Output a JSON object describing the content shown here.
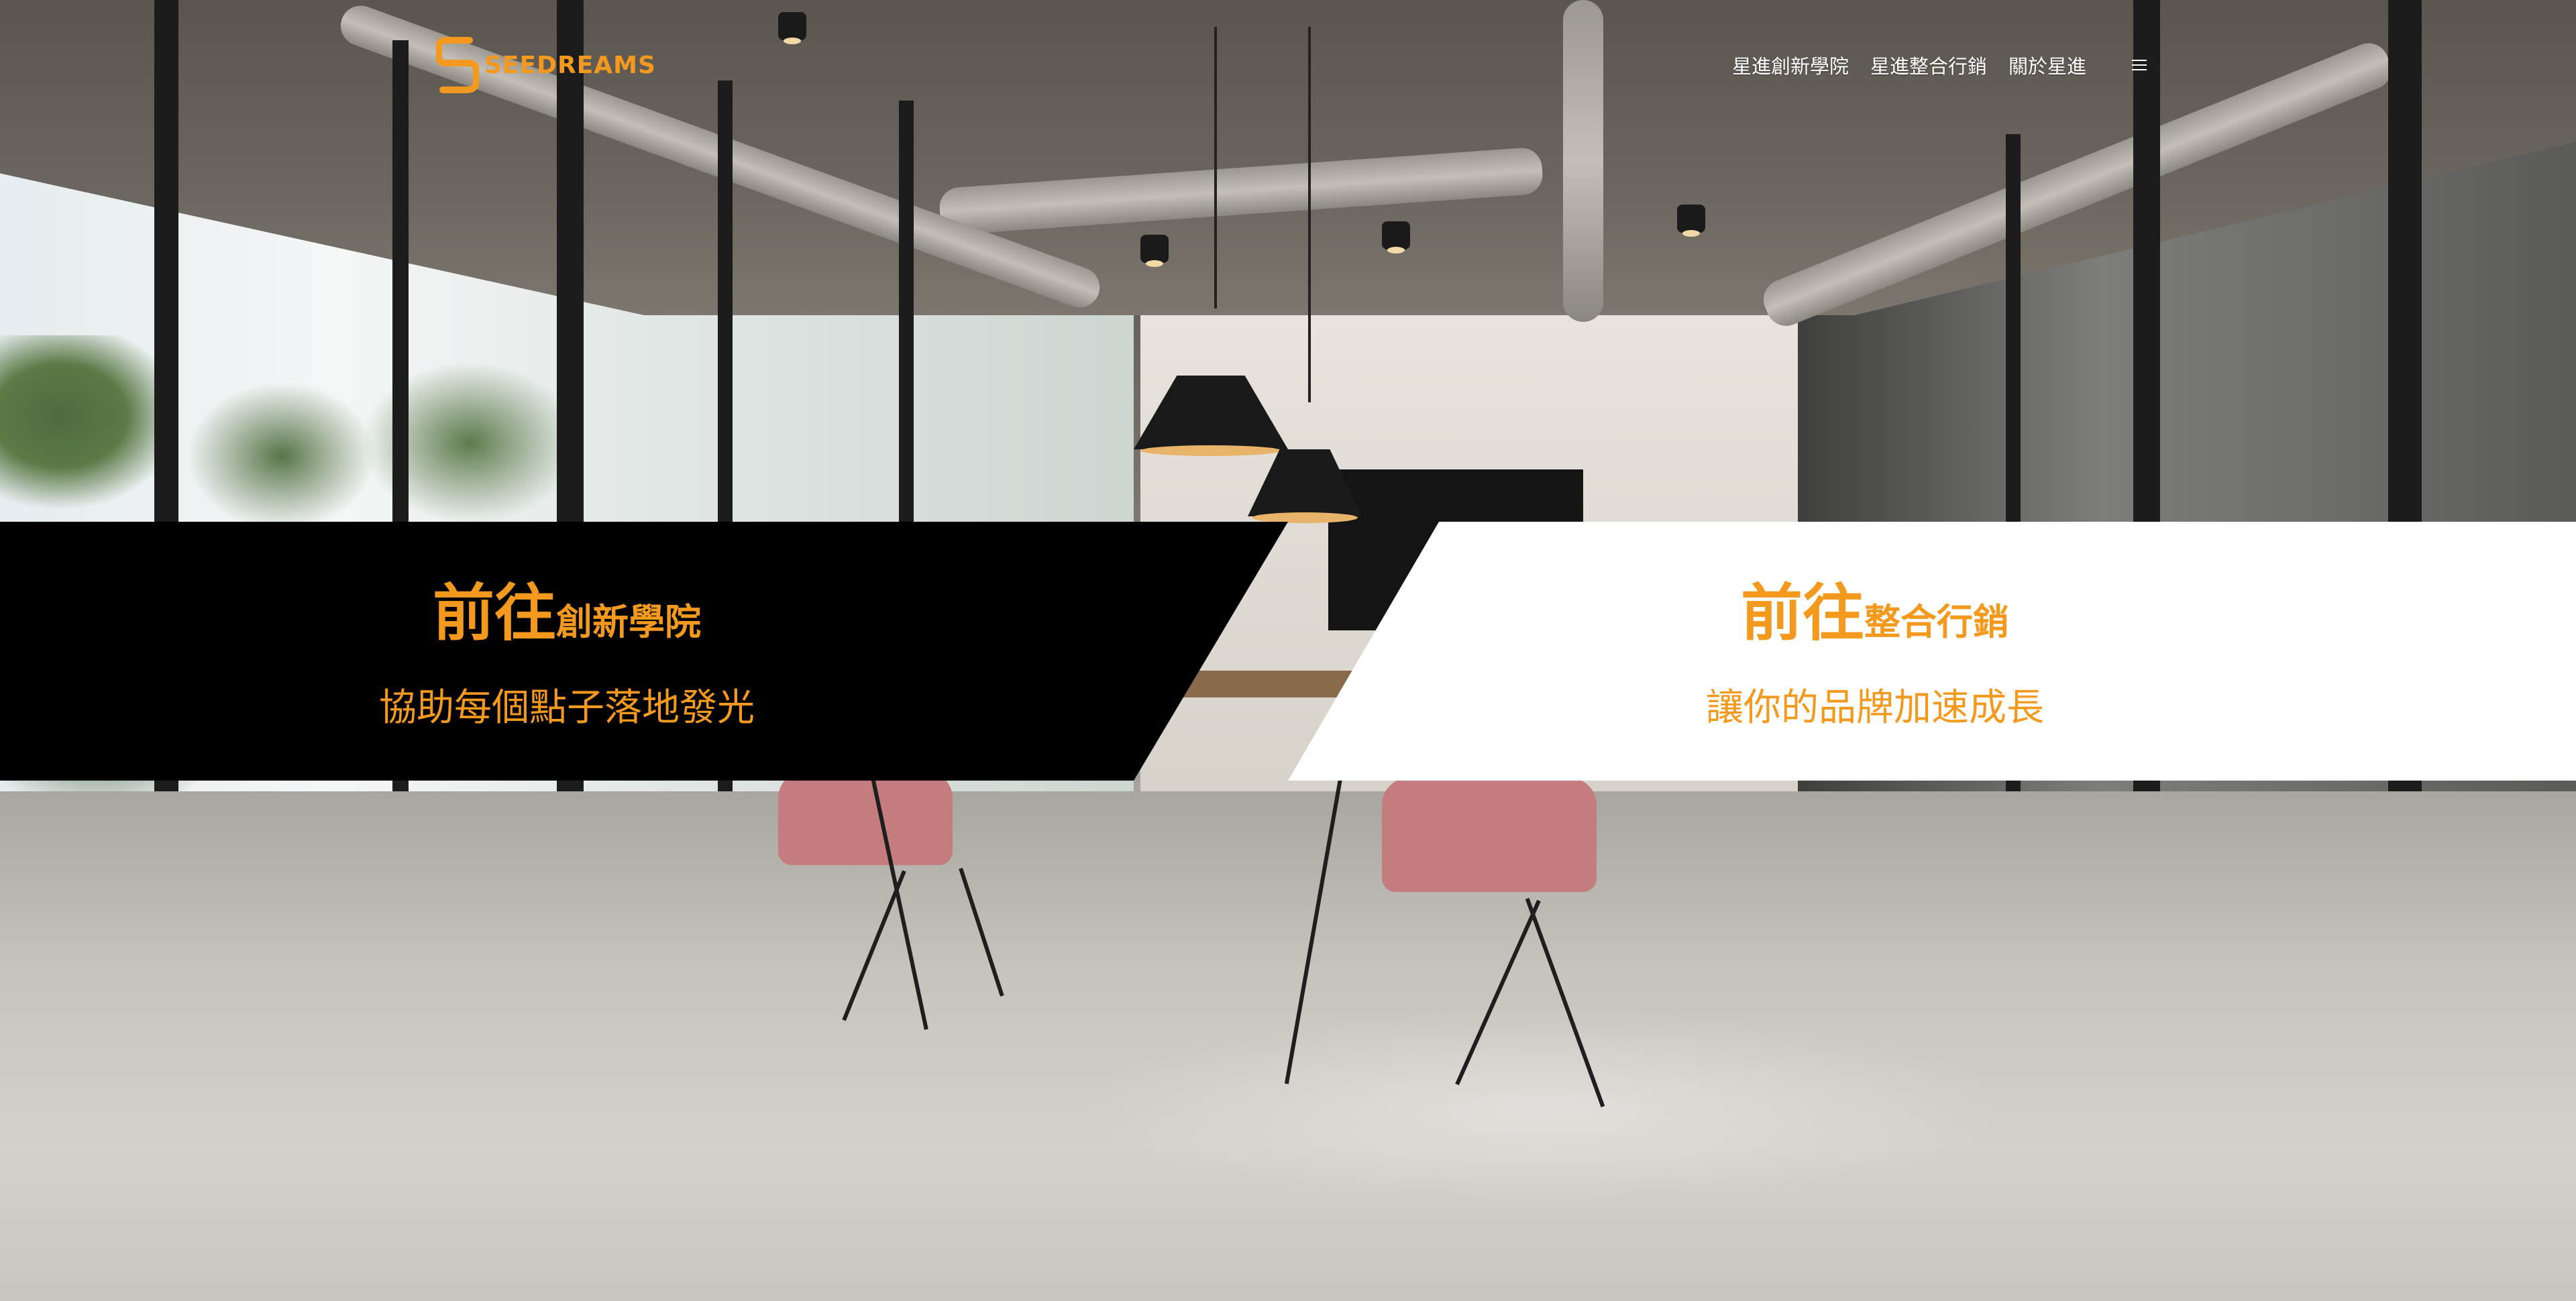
{
  "brand": {
    "logo_text": "SEEDREAMS",
    "accent_color": "#f39a1e"
  },
  "nav": {
    "items": [
      {
        "label": "星進創新學院"
      },
      {
        "label": "星進整合行銷"
      },
      {
        "label": "關於星進"
      }
    ],
    "menu_icon": "hamburger-menu-icon"
  },
  "panels": {
    "academy": {
      "title_prefix": "前往",
      "title_name": "創新學院",
      "subtitle": "協助每個點子落地發光",
      "background": "#000000"
    },
    "marketing": {
      "title_prefix": "前往",
      "title_name": "整合行銷",
      "subtitle": "讓你的品牌加速成長",
      "background": "#ffffff"
    }
  }
}
